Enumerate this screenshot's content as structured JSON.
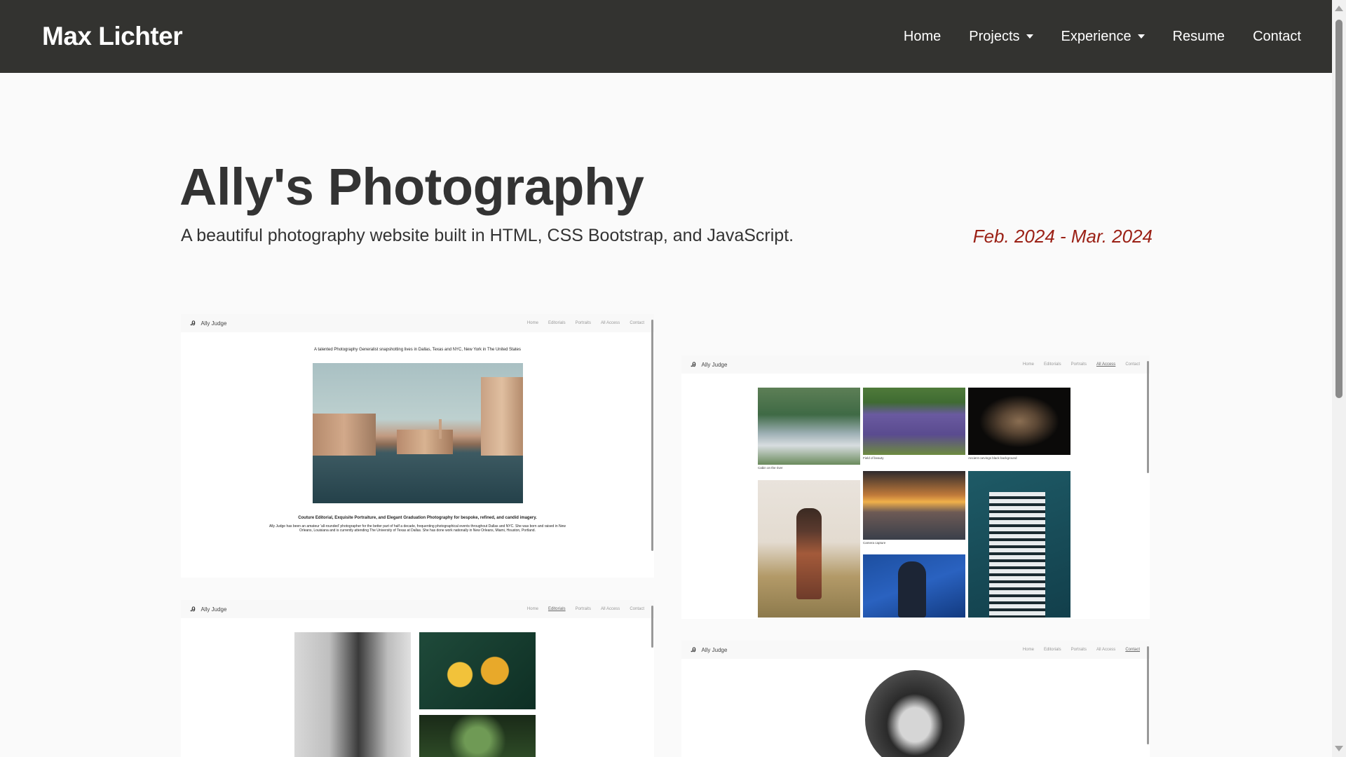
{
  "navbar": {
    "brand": "Max Lichter",
    "items": [
      {
        "label": "Home",
        "dropdown": false
      },
      {
        "label": "Projects",
        "dropdown": true
      },
      {
        "label": "Experience",
        "dropdown": true
      },
      {
        "label": "Resume",
        "dropdown": false
      },
      {
        "label": "Contact",
        "dropdown": false
      }
    ]
  },
  "project": {
    "title": "Ally's Photography",
    "subtitle": "A beautiful photography website built in HTML, CSS Bootstrap, and JavaScript.",
    "dates": "Feb. 2024 - Mar. 2024"
  },
  "screenshots": {
    "site_name": "Ally Judge",
    "nav_links": [
      "Home",
      "Editorials",
      "Portraits",
      "All Access",
      "Contact"
    ],
    "home": {
      "tagline": "A talented Photography Generalist snapshotting lives in Dallas, Texas and NYC, New York in The United States",
      "services": "Couture Editorial, Exquisite Portraiture, and Elegant Graduation Photography for bespoke, refined, and candid imagery.",
      "bio": "Ally Judge has been an amateur 'all-rounded' photographer for the better part of half a decade, frequenting photographical events throughout Dallas and NYC. She was born and raised in New Orleans, Louisiana and is currently attending The University of Texas at Dallas. She has done work nationally in New Orleans, Miami, Houston, Portland."
    },
    "gallery": {
      "captions": [
        "Cabin on the river",
        "Field of beauty",
        "Ancient carvings black background",
        "Camera capture"
      ]
    }
  },
  "colors": {
    "navbar_bg": "#333330",
    "accent_date": "#9b2116",
    "page_bg": "#fafafa"
  }
}
